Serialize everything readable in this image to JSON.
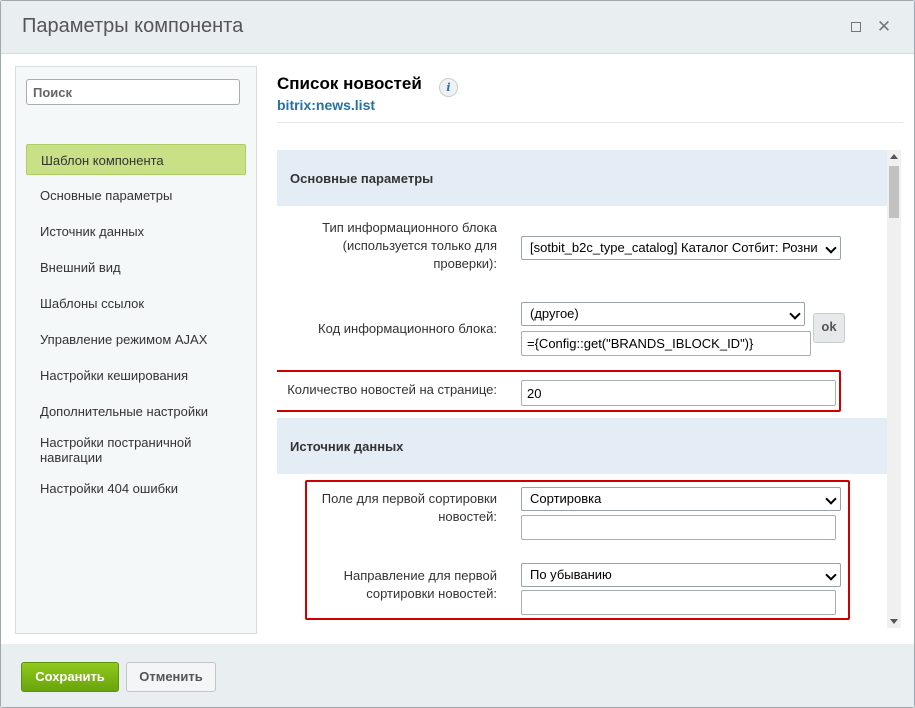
{
  "window": {
    "title": "Параметры компонента"
  },
  "titlebar_icons": [
    "maximize-icon",
    "close-icon"
  ],
  "sidebar": {
    "search_placeholder": "Поиск",
    "items": [
      {
        "label": "Шаблон компонента",
        "active": true
      },
      {
        "label": "Основные параметры"
      },
      {
        "label": "Источник данных"
      },
      {
        "label": "Внешний вид"
      },
      {
        "label": "Шаблоны ссылок"
      },
      {
        "label": "Управление режимом AJAX"
      },
      {
        "label": "Настройки кеширования"
      },
      {
        "label": "Дополнительные настройки"
      },
      {
        "label": "Настройки постраничной навигации"
      },
      {
        "label": "Настройки 404 ошибки"
      }
    ]
  },
  "component": {
    "title": "Список новостей",
    "info_icon": "i",
    "code": "bitrix:news.list"
  },
  "sections": {
    "basic": "Основные параметры",
    "datasource": "Источник данных"
  },
  "fields": {
    "iblock_type": {
      "label": "Тип информационного блока (используется только для проверки):",
      "value": "[sotbit_b2c_type_catalog] Каталог Сотбит: Розни"
    },
    "iblock_code": {
      "label": "Код информационного блока:",
      "select_value": "(другое)",
      "input_value": "={Config::get(\"BRANDS_IBLOCK_ID\")}",
      "ok_label": "ok"
    },
    "news_count": {
      "label": "Количество новостей на странице:",
      "value": "20"
    },
    "sort_by1": {
      "label": "Поле для первой сортировки новостей:",
      "value": "Сортировка",
      "input_value": ""
    },
    "sort_order1": {
      "label": "Направление для первой сортировки новостей:",
      "value": "По убыванию",
      "input_value": ""
    }
  },
  "footer": {
    "save_label": "Сохранить",
    "cancel_label": "Отменить"
  },
  "colors": {
    "highlight": "#cc0000",
    "active_nav": "#c8e086",
    "save_button": "#7ab514",
    "section_bg": "#e4edf5",
    "link": "#2272a8"
  }
}
